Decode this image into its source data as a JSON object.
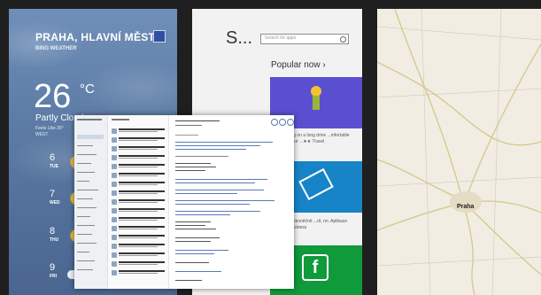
{
  "weather": {
    "city": "PRAHA, HLAVNÍ MĚST...",
    "app_name": "BING WEATHER",
    "temperature": "26",
    "unit": "°C",
    "condition": "Partly Cloudy",
    "feels_like": "Feels Like 26°",
    "extra": "WEST",
    "forecast": [
      {
        "num": "6",
        "day": "TUE"
      },
      {
        "num": "7",
        "day": "WED"
      },
      {
        "num": "8",
        "day": "THU"
      },
      {
        "num": "9",
        "day": "FRI"
      }
    ]
  },
  "store": {
    "title": "S...",
    "search_placeholder": "Search for apps",
    "popular_label": "Popular now ›",
    "tile1_text": "...Rush ...ng on a long drive ...mfortable couch in your ...★★ Travel",
    "tile2_text": "...beberu nekoněčně ...rit, nn. Aplikace ...★★★ Business",
    "facebook_glyph": "f"
  },
  "map": {
    "city": "Praha"
  },
  "colors": {
    "weather_bg": "#5f7ea7",
    "store_tile_purple": "#5b4fd1",
    "store_tile_blue": "#1684c7",
    "store_tile_green": "#109a3b"
  }
}
